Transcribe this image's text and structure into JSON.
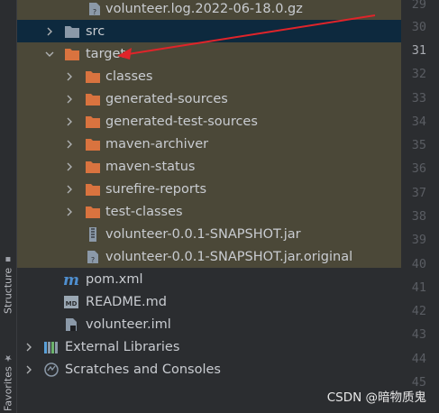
{
  "sidebar": {
    "structure_label": "Structure",
    "favorites_label": "Favorites"
  },
  "tree": {
    "rows": [
      {
        "label": "volunteer.log.2022-06-18.0.gz"
      },
      {
        "label": "src"
      },
      {
        "label": "target"
      },
      {
        "label": "classes"
      },
      {
        "label": "generated-sources"
      },
      {
        "label": "generated-test-sources"
      },
      {
        "label": "maven-archiver"
      },
      {
        "label": "maven-status"
      },
      {
        "label": "surefire-reports"
      },
      {
        "label": "test-classes"
      },
      {
        "label": "volunteer-0.0.1-SNAPSHOT.jar"
      },
      {
        "label": "volunteer-0.0.1-SNAPSHOT.jar.original"
      },
      {
        "label": "pom.xml"
      },
      {
        "label": "README.md"
      },
      {
        "label": "volunteer.iml"
      },
      {
        "label": "External Libraries"
      },
      {
        "label": "Scratches and Consoles"
      }
    ]
  },
  "gutter": {
    "line_numbers": [
      "29",
      "30",
      "31",
      "32",
      "33",
      "34",
      "35",
      "36",
      "37",
      "38",
      "39",
      "40",
      "41",
      "42",
      "43",
      "44",
      "45"
    ],
    "current_line": "31"
  },
  "watermark": "CSDN @暗物质鬼",
  "colors": {
    "background": "#2b2d30",
    "highlight_row": "#4b4838",
    "selected_row": "#0d293e",
    "folder": "#d9733f",
    "arrow": "#e0242a"
  }
}
